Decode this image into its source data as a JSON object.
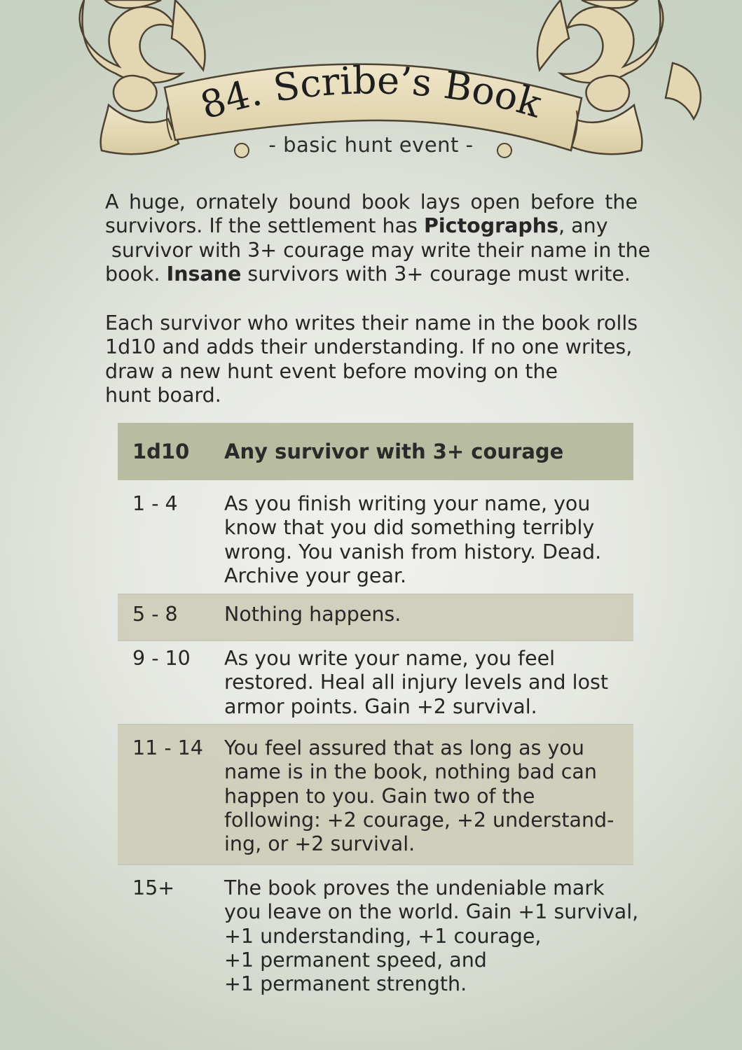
{
  "card": {
    "title": "84. Scribe’s Book",
    "subtitle": "- basic hunt event -"
  },
  "intro": {
    "p1": [
      {
        "text": "A huge, ornately bound book lays open before the",
        "justify": true
      },
      {
        "parts": [
          "survivors. If the settlement has ",
          "Pictographs",
          ", any"
        ]
      },
      {
        "parts": [
          " survivor with 3+ courage may write their name in the"
        ]
      },
      {
        "parts": [
          "book. ",
          "Insane",
          " survivors with 3+ courage must write."
        ]
      }
    ],
    "p2": [
      "Each survivor who writes their name in the book rolls",
      "1d10 and adds their understanding. If no one writes,",
      "draw a new hunt event before moving on the",
      "hunt board."
    ]
  },
  "table": {
    "header": {
      "roll": "1d10",
      "result": "Any survivor with 3+ courage"
    },
    "rows": [
      {
        "roll": "1 - 4",
        "lines": [
          "As you finish writing your name, you",
          "know that you did something terribly",
          "wrong. You vanish from history. Dead.",
          "Archive your gear."
        ]
      },
      {
        "roll": "5 - 8",
        "lines": [
          "Nothing happens."
        ]
      },
      {
        "roll": "9 - 10",
        "lines": [
          "As you write your name, you feel",
          "restored. Heal all injury levels and lost",
          "armor points. Gain +2 survival."
        ]
      },
      {
        "roll": "11 - 14",
        "lines": [
          "You feel assured that as long as you",
          "name is in the book, nothing bad can",
          "happen to you. Gain two of the",
          "following: +2 courage, +2 understand-",
          "ing, or +2 survival."
        ]
      },
      {
        "roll": "15+",
        "lines": [
          "The book proves the undeniable mark",
          "you leave on the world. Gain +1 survival,",
          "+1 understanding, +1 courage,",
          "+1 permanent speed, and",
          "+1 permanent strength."
        ]
      }
    ]
  }
}
